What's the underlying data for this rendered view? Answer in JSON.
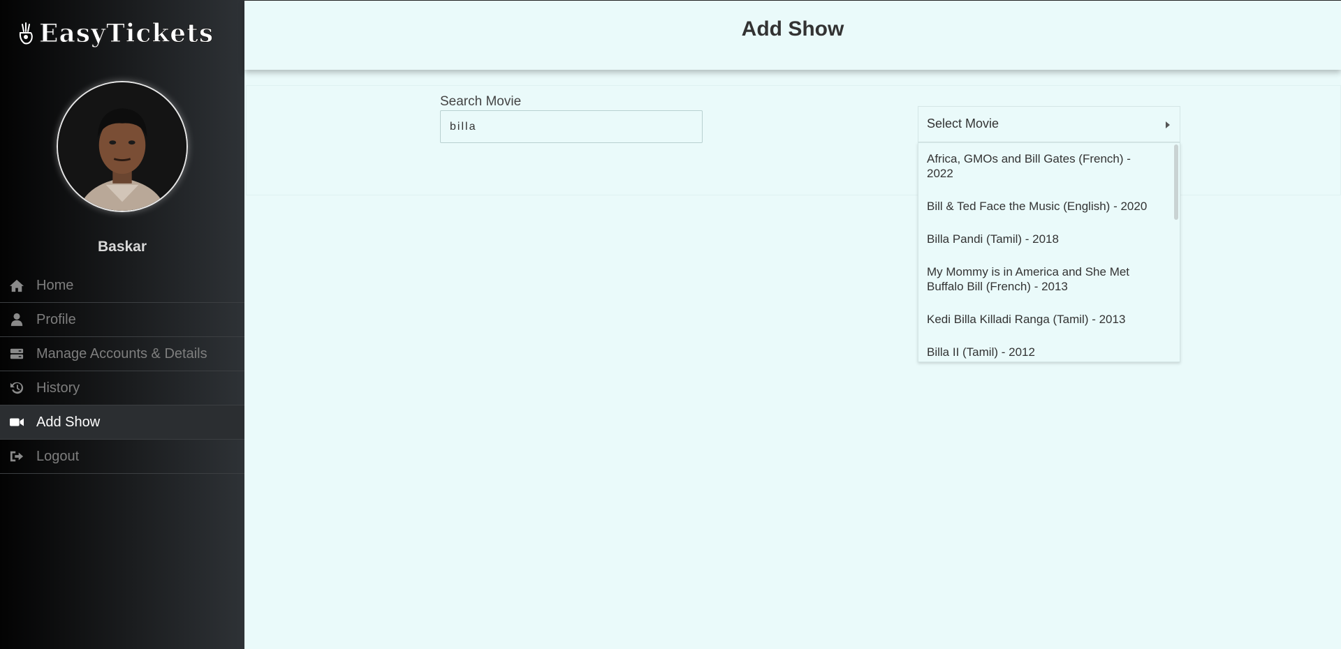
{
  "app": {
    "logo_text": "EasyTickets"
  },
  "user": {
    "name": "Baskar"
  },
  "nav": {
    "items": [
      {
        "label": "Home",
        "icon": "home-icon"
      },
      {
        "label": "Profile",
        "icon": "user-icon"
      },
      {
        "label": "Manage Accounts & Details",
        "icon": "server-icon"
      },
      {
        "label": "History",
        "icon": "history-icon"
      },
      {
        "label": "Add Show",
        "icon": "video-camera-icon",
        "active": true
      },
      {
        "label": "Logout",
        "icon": "sign-out-icon"
      }
    ]
  },
  "header": {
    "title": "Add Show"
  },
  "form": {
    "search_label": "Search Movie",
    "search_value": "billa",
    "select_label": "Select Movie",
    "options": [
      "Africa, GMOs and Bill Gates (French) - 2022",
      "Bill & Ted Face the Music (English) - 2020",
      "Billa Pandi (Tamil) - 2018",
      "My Mommy is in America and She Met Buffalo Bill (French) - 2013",
      "Kedi Billa Killadi Ranga (Tamil) - 2013",
      "Billa II (Tamil) - 2012"
    ]
  },
  "colors": {
    "background": "#eafafa",
    "sidebar_dark": "#030303",
    "active_text": "#ffffff",
    "inactive_text": "#7e7e7e"
  }
}
